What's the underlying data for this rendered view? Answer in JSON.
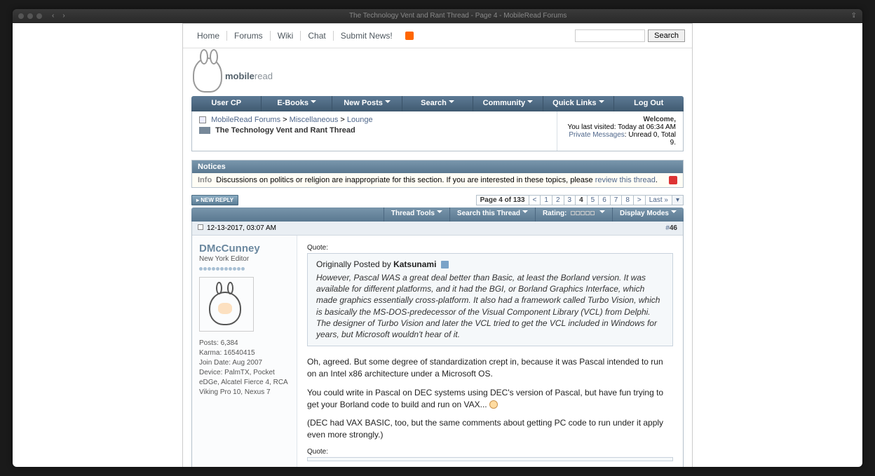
{
  "window": {
    "title": "The Technology Vent and Rant Thread - Page 4 - MobileRead Forums",
    "back": "‹",
    "forward": "›"
  },
  "topnav": {
    "items": [
      "Home",
      "Forums",
      "Wiki",
      "Chat",
      "Submit News!"
    ],
    "search_placeholder": "",
    "search_button": "Search"
  },
  "logo": {
    "text_bold": "mobile",
    "text_light": "read"
  },
  "navbar": {
    "items": [
      {
        "label": "User CP",
        "dropdown": false
      },
      {
        "label": "E-Books",
        "dropdown": true
      },
      {
        "label": "New Posts",
        "dropdown": true
      },
      {
        "label": "Search",
        "dropdown": true
      },
      {
        "label": "Community",
        "dropdown": true
      },
      {
        "label": "Quick Links",
        "dropdown": true
      },
      {
        "label": "Log Out",
        "dropdown": false
      }
    ]
  },
  "breadcrumb": {
    "path": [
      "MobileRead Forums",
      "Miscellaneous",
      "Lounge"
    ],
    "sep": " > ",
    "thread_title": "The Technology Vent and Rant Thread",
    "welcome": "Welcome,",
    "visited_prefix": "You last visited: ",
    "visited_time": "Today at 06:34 AM",
    "pm_prefix": "Private Messages",
    "pm_stats": ": Unread 0, Total 9."
  },
  "notices": {
    "header": "Notices",
    "info_tag": "Info",
    "text_before": "Discussions on politics or religion are inappropriate for this section. If you are interested in these topics, please ",
    "link": "review this thread",
    "text_after": "."
  },
  "newreply": {
    "label": "NEW REPLY"
  },
  "pagination": {
    "current_label": "Page 4 of 133",
    "prev": "<",
    "pages": [
      "1",
      "2",
      "3",
      "4",
      "5",
      "6",
      "7",
      "8"
    ],
    "current": "4",
    "next": ">",
    "last": "Last »",
    "menu": "▾"
  },
  "thread_tools": {
    "items": [
      {
        "label": "Thread Tools",
        "dropdown": true
      },
      {
        "label": "Search this Thread",
        "dropdown": true
      },
      {
        "label": "Rating:",
        "dropdown": true,
        "stars": true
      },
      {
        "label": "Display Modes",
        "dropdown": true
      }
    ]
  },
  "post": {
    "date": "12-13-2017, 03:07 AM",
    "number_prefix": "#",
    "number": "46",
    "user": {
      "name": "DMcCunney",
      "title": "New York Editor",
      "pip_count": 11,
      "stats": {
        "posts_label": "Posts: ",
        "posts": "6,384",
        "karma_label": "Karma: ",
        "karma": "16540415",
        "join_label": "Join Date: ",
        "join": "Aug 2007",
        "device_label": "Device: ",
        "device": "PalmTX, Pocket eDGe, Alcatel Fierce 4, RCA Viking Pro 10, Nexus 7"
      }
    },
    "quote_label": "Quote:",
    "quote": {
      "originally_prefix": "Originally Posted by ",
      "author": "Katsunami",
      "text": "However, Pascal WAS a great deal better than Basic, at least the Borland version. It was available for different platforms, and it had the BGI, or Borland Graphics Interface, which made graphics essentially cross-platform. It also had a framework called Turbo Vision, which is basically the MS-DOS-predecessor of the Visual Component Library (VCL) from Delphi. The designer of Turbo Vision and later the VCL tried to get the VCL included in Windows for years, but Microsoft wouldn't hear of it."
    },
    "body": {
      "p1": "Oh, agreed. But some degree of standardization crept in, because it was Pascal intended to run on an Intel x86 architecture under a Microsoft OS.",
      "p2": "You could write in Pascal on DEC systems using DEC's version of Pascal, but have fun trying to get your Borland code to build and run on VAX... ",
      "p3": "(DEC had VAX BASIC, too, but the same comments about getting PC code to run under it apply even more strongly.)"
    },
    "quote_label_2": "Quote:"
  }
}
